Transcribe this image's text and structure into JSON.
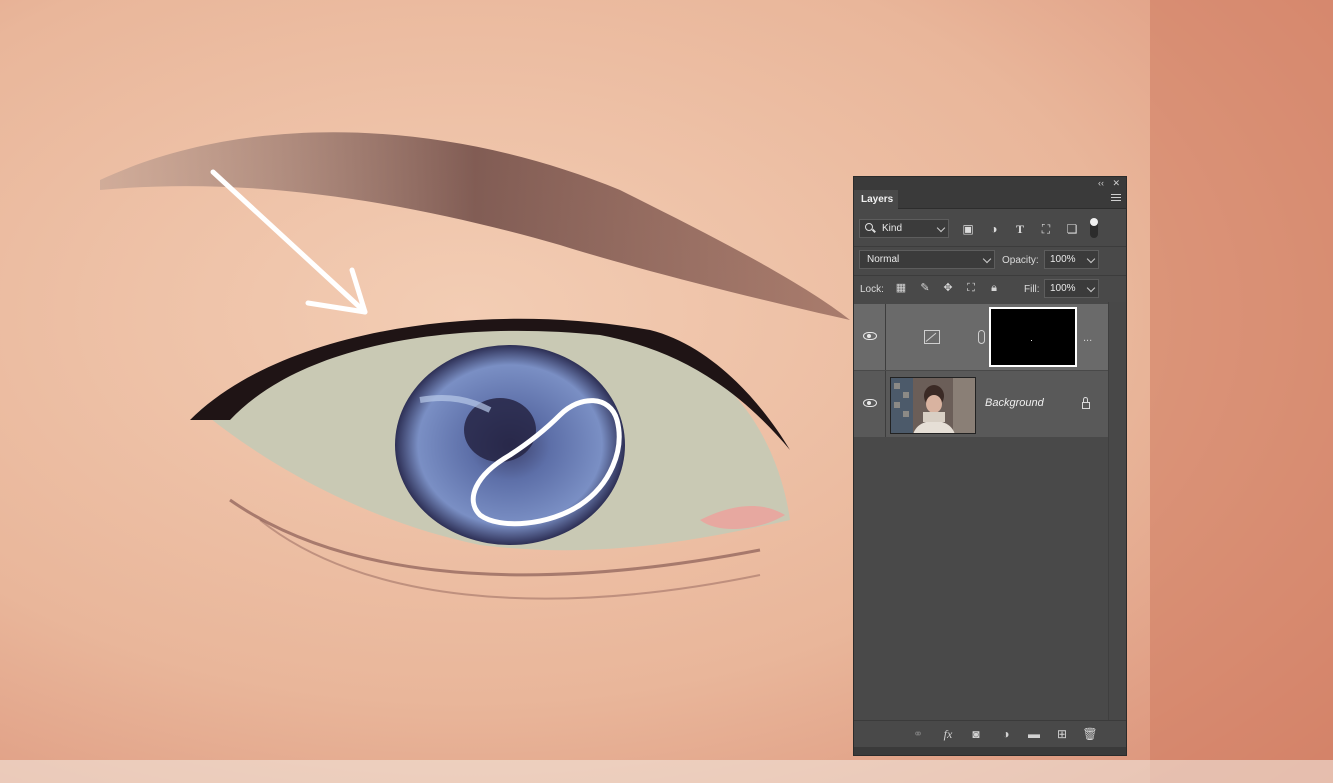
{
  "panel": {
    "collapse_label": "‹‹",
    "close_label": "✕",
    "tab_title": "Layers",
    "filter": {
      "kind_label": "Kind",
      "icons": [
        "image-filter-icon",
        "adjustment-filter-icon",
        "type-filter-icon",
        "shape-filter-icon",
        "smart-object-filter-icon"
      ]
    },
    "blend_mode": "Normal",
    "opacity_label": "Opacity:",
    "opacity_value": "100%",
    "lock_label": "Lock:",
    "fill_label": "Fill:",
    "fill_value": "100%",
    "layers": [
      {
        "kind": "adjustment",
        "name": "",
        "selected": true,
        "more": "..."
      },
      {
        "kind": "pixel",
        "name": "Background",
        "locked": true
      }
    ],
    "bottom_icons": [
      "link-layers-icon",
      "fx-icon",
      "add-mask-icon",
      "adjustment-layer-icon",
      "group-folder-icon",
      "new-layer-icon",
      "trash-icon"
    ],
    "fx_label": "fx"
  },
  "colors": {
    "panel_bg": "#494949",
    "selected_layer": "#6a6a6a",
    "annotation": "#ffffff"
  }
}
